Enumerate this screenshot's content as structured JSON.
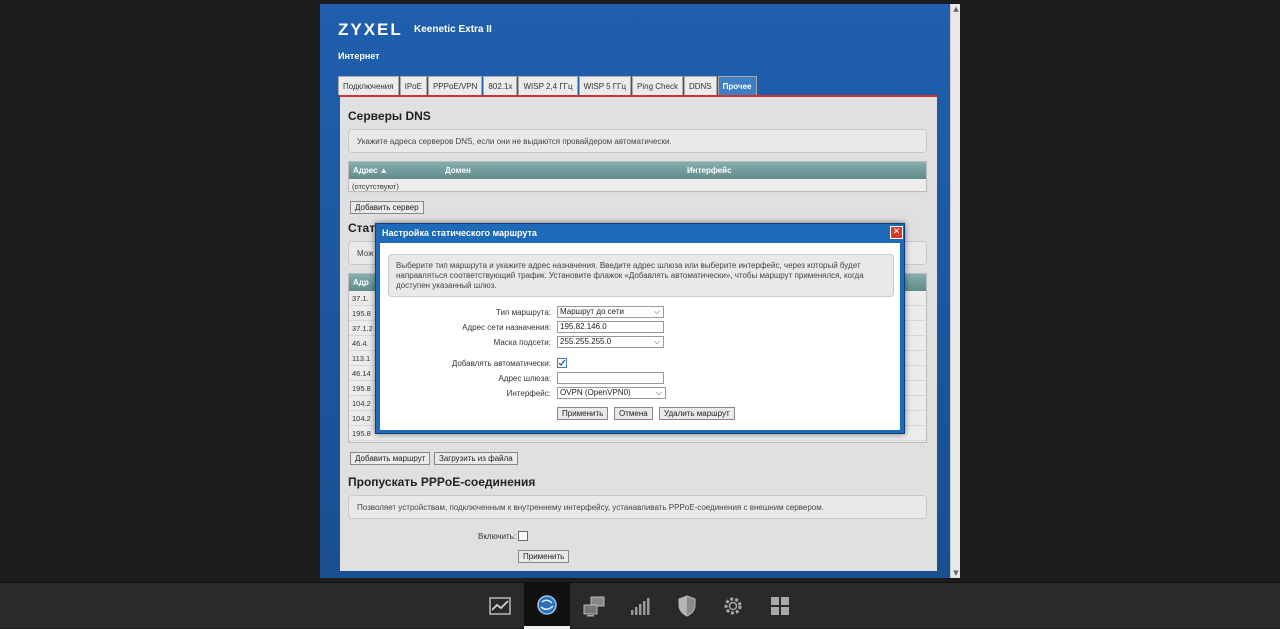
{
  "header": {
    "logo": "ZYXEL",
    "model": "Keenetic Extra II",
    "section": "Интернет"
  },
  "tabs": [
    {
      "label": "Подключения"
    },
    {
      "label": "IPoE"
    },
    {
      "label": "PPPoE/VPN"
    },
    {
      "label": "802.1x"
    },
    {
      "label": "WISP 2,4 ГГц"
    },
    {
      "label": "WISP 5 ГГц"
    },
    {
      "label": "Ping Check"
    },
    {
      "label": "DDNS"
    },
    {
      "label": "Прочее",
      "active": true
    }
  ],
  "dns": {
    "title": "Серверы DNS",
    "info": "Укажите адреса серверов DNS, если они не выдаются провайдером автоматически.",
    "columns": [
      "Адрес ▲",
      "Домен",
      "Интерфейс"
    ],
    "empty_row": "(отсутствуют)",
    "add_button": "Добавить сервер"
  },
  "routes": {
    "title": "Стат",
    "info": "Мож",
    "column": "Адр",
    "rows": [
      "37.1.",
      "195.8",
      "37.1.2",
      "46.4.",
      "113.1",
      "46.14",
      "195.8",
      "104.2",
      "104.2",
      "195.8"
    ],
    "add_button": "Добавить маршрут",
    "load_button": "Загрузить из файла"
  },
  "pppoe": {
    "title": "Пропускать PPPoE-соединения",
    "info": "Позволяет устройствам, подключенным к внутреннему интерфейсу, устанавливать PPPoE-соединения с внешним сервером.",
    "enable_label": "Включить:",
    "apply_button": "Применить"
  },
  "dialog": {
    "title": "Настройка статического маршрута",
    "info": "Выберите тип маршрута и укажите адрес назначения. Введите адрес шлюза или выберите интерфейс, через который будет направляться соответствующий трафик. Установите флажок «Добавлять автоматически», чтобы маршрут применялся, когда доступен указанный шлюз.",
    "route_type_label": "Тип маршрута:",
    "route_type_value": "Маршрут до сети",
    "dest_label": "Адрес сети назначения:",
    "dest_value": "195.82.146.0",
    "mask_label": "Маска подсети:",
    "mask_value": "255.255.255.0",
    "auto_label": "Добавлять автоматически:",
    "auto_checked": true,
    "gateway_label": "Адрес шлюза:",
    "gateway_value": "",
    "interface_label": "Интерфейс:",
    "interface_value": "OVPN (OpenVPN0)",
    "apply_button": "Применить",
    "cancel_button": "Отмена",
    "delete_button": "Удалить маршрут"
  },
  "taskbar": {
    "items": [
      {
        "icon": "chart-icon"
      },
      {
        "icon": "globe-icon",
        "active": true
      },
      {
        "icon": "network-icon"
      },
      {
        "icon": "signal-icon"
      },
      {
        "icon": "shield-icon"
      },
      {
        "icon": "gear-icon"
      },
      {
        "icon": "apps-icon"
      }
    ]
  }
}
